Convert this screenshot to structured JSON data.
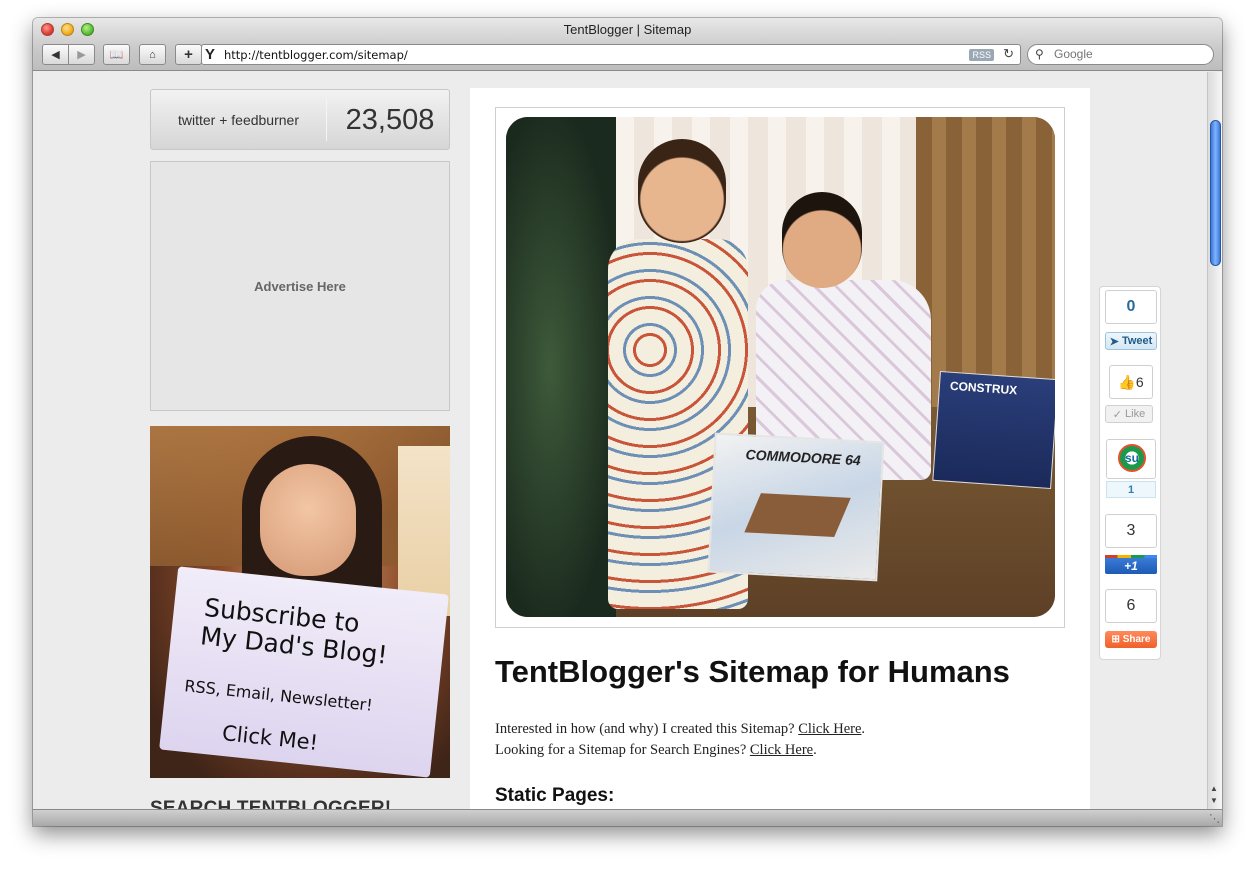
{
  "window": {
    "title": "TentBlogger | Sitemap"
  },
  "toolbar": {
    "back_icon": "◀",
    "forward_icon": "▶",
    "bookmarks_icon": "📖",
    "home_icon": "⌂",
    "add_label": "+",
    "url": "http://tentblogger.com/sitemap/",
    "rss_label": "RSS",
    "reload_icon": "↻",
    "search_placeholder": "Google"
  },
  "sidebar": {
    "counter_label": "twitter + feedburner",
    "counter_value": "23,508",
    "ad_label": "Advertise Here",
    "subscribe_sign": {
      "line1": "Subscribe to",
      "line2": "My Dad's Blog!",
      "line3": "RSS, Email, Newsletter!",
      "line4": "Click Me!"
    },
    "search_heading": "SEARCH TENTBLOGGER!"
  },
  "main": {
    "hero_box_text": "COMMODORE 64",
    "hero_box2_text": "CONSTRUX",
    "title": "TentBlogger's Sitemap for Humans",
    "intro_line1": "Interested in how (and why) I created this Sitemap? ",
    "intro_link1": "Click Here",
    "intro_line2": "Looking for a Sitemap for Search Engines? ",
    "intro_link2": "Click Here",
    "period": ".",
    "section_heading": "Static Pages:"
  },
  "share": {
    "tweet_count": "0",
    "tweet_label": "Tweet",
    "like_count": "6",
    "like_label": "Like",
    "stumble_count": "1",
    "plusone_count": "3",
    "plusone_label": "+1",
    "share_count": "6",
    "share_label": "Share"
  },
  "colors": {
    "scroll_thumb": "#3b78d6",
    "tweet_text": "#1f5c8b",
    "share_button": "#f0602a"
  }
}
